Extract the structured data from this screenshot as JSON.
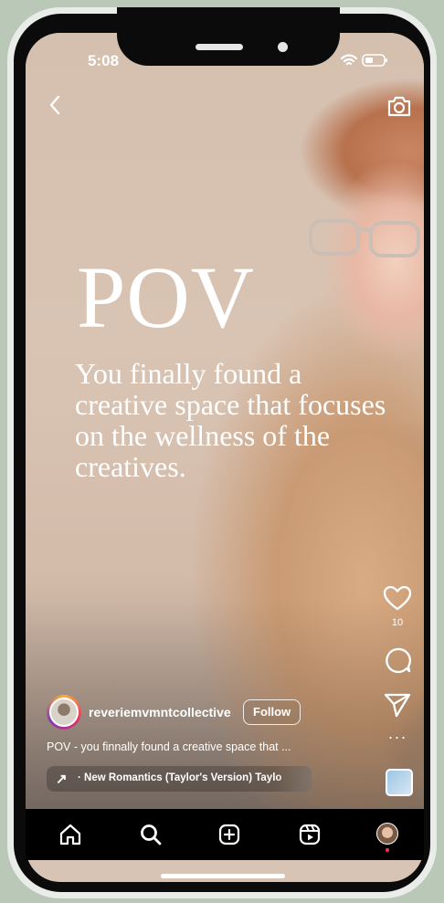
{
  "status_bar": {
    "time": "5:08"
  },
  "overlay": {
    "title": "POV",
    "text": "You finally found a creative space that focuses on the wellness of the creatives."
  },
  "actions": {
    "like_count": "10",
    "more": "···"
  },
  "post": {
    "username": "reveriemvmntcollective",
    "follow_label": "Follow",
    "caption": "POV - you finnally found a creative space that ...",
    "audio": "· New Romantics (Taylor's Version)   Taylo"
  },
  "icons": {
    "back": "chevron-left",
    "camera": "camera",
    "like": "heart",
    "comment": "speech-bubble",
    "share": "paper-plane",
    "home": "home",
    "search": "magnifier",
    "create": "plus-square",
    "reels": "reels",
    "profile": "avatar"
  },
  "colors": {
    "frame": "#e9ece8",
    "background": "#b9c8b7",
    "tab_dot": "#ff3040"
  }
}
